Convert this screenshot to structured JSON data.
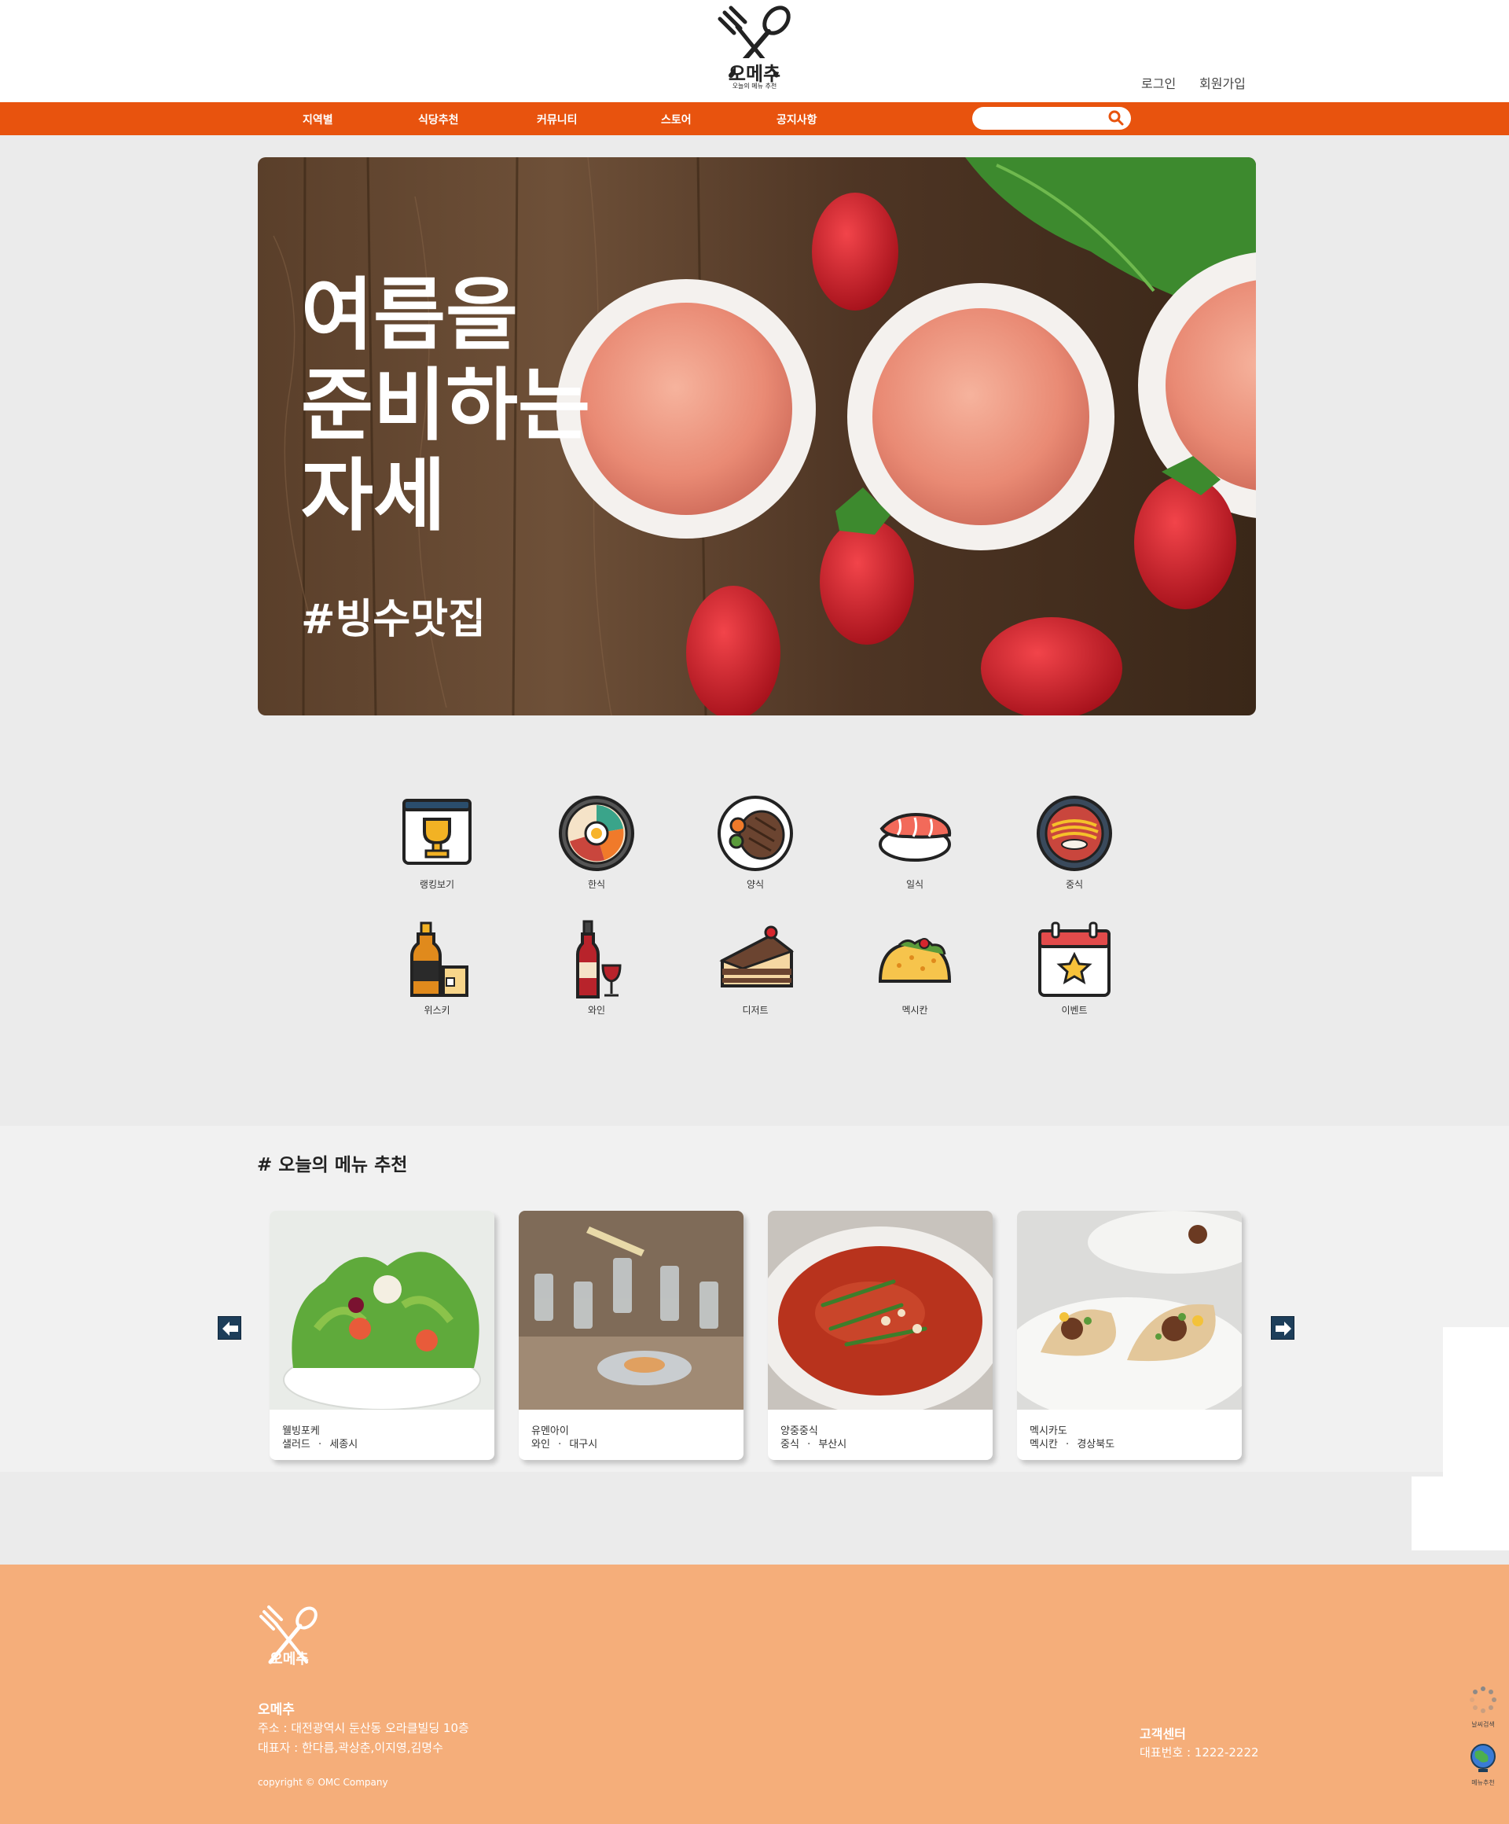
{
  "header": {
    "logo_text": "오메추",
    "logo_sub": "오늘의 메뉴 추천",
    "login": "로그인",
    "signup": "회원가입"
  },
  "nav": {
    "items": [
      "지역별",
      "식당추천",
      "커뮤니티",
      "스토어",
      "공지사항"
    ],
    "search_placeholder": ""
  },
  "banner": {
    "headline_1": "여름을",
    "headline_2": "준비하는",
    "headline_3": "자세",
    "hashtag": "#빙수맛집"
  },
  "categories": [
    {
      "label": "랭킹보기",
      "icon": "trophy-icon"
    },
    {
      "label": "한식",
      "icon": "bibimbap-icon"
    },
    {
      "label": "양식",
      "icon": "steak-icon"
    },
    {
      "label": "일식",
      "icon": "sushi-icon"
    },
    {
      "label": "중식",
      "icon": "noodle-bowl-icon"
    },
    {
      "label": "위스키",
      "icon": "whiskey-icon"
    },
    {
      "label": "와인",
      "icon": "wine-icon"
    },
    {
      "label": "디저트",
      "icon": "cake-icon"
    },
    {
      "label": "멕시칸",
      "icon": "taco-icon"
    },
    {
      "label": "이벤트",
      "icon": "calendar-icon"
    }
  ],
  "recommend": {
    "title": "# 오늘의 메뉴 추천",
    "cards": [
      {
        "name": "웰빙포케",
        "category": "샐러드",
        "region": "세종시"
      },
      {
        "name": "유멘아이",
        "category": "와인",
        "region": "대구시"
      },
      {
        "name": "양중중식",
        "category": "중식",
        "region": "부산시"
      },
      {
        "name": "멕시카도",
        "category": "멕시칸",
        "region": "경상북도"
      }
    ],
    "separator": "·"
  },
  "footer": {
    "brand": "오메추",
    "address": "주소 : 대전광역시 둔산동 오라클빌딩 10층",
    "ceo": "대표자 : 한다름,곽상춘,이지영,김명수",
    "copyright": "copyright © OMC Company",
    "cs_title": "고객센터",
    "cs_phone": "대표번호 : 1222-2222"
  },
  "quick": {
    "weather": "날씨검색",
    "menu": "메뉴추천"
  },
  "colors": {
    "accent": "#e8530e",
    "footer_bg": "#f5ae7a",
    "arrow_bg": "#1d3e5a"
  }
}
